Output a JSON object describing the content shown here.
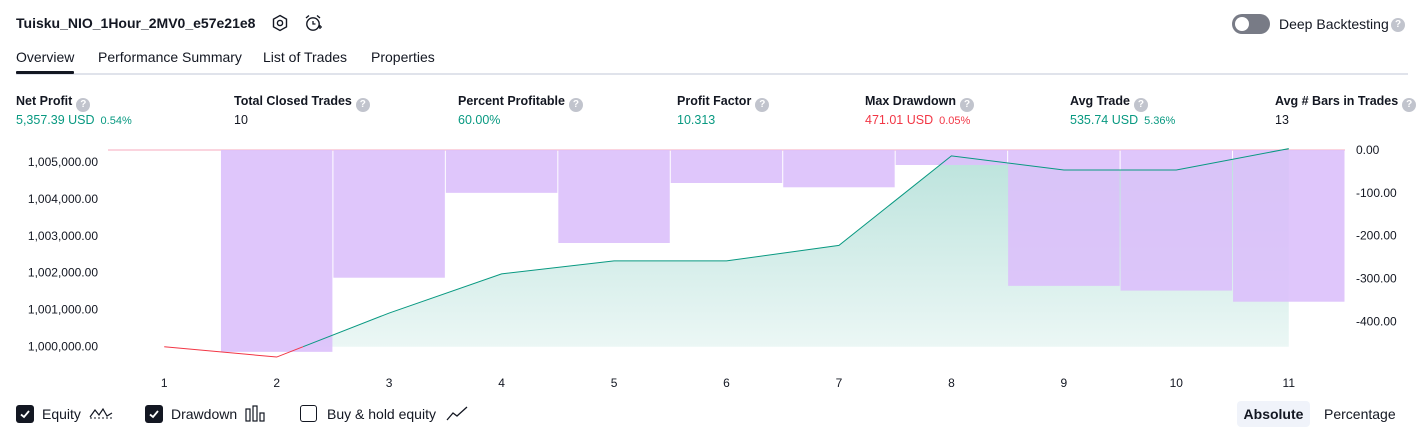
{
  "header": {
    "title": "Tuisku_NIO_1Hour_2MV0_e57e21e8",
    "deep_backtesting_label": "Deep Backtesting",
    "deep_backtesting_enabled": false
  },
  "tabs": [
    {
      "label": "Overview",
      "active": true
    },
    {
      "label": "Performance Summary",
      "active": false
    },
    {
      "label": "List of Trades",
      "active": false
    },
    {
      "label": "Properties",
      "active": false
    }
  ],
  "stats": [
    {
      "label": "Net Profit",
      "value": "5,357.39 USD",
      "sub": "0.54%",
      "color": "#089981"
    },
    {
      "label": "Total Closed Trades",
      "value": "10",
      "sub": "",
      "color": "#131722"
    },
    {
      "label": "Percent Profitable",
      "value": "60.00%",
      "sub": "",
      "color": "#089981"
    },
    {
      "label": "Profit Factor",
      "value": "10.313",
      "sub": "",
      "color": "#089981"
    },
    {
      "label": "Max Drawdown",
      "value": "471.01 USD",
      "sub": "0.05%",
      "color": "#f23645"
    },
    {
      "label": "Avg Trade",
      "value": "535.74 USD",
      "sub": "5.36%",
      "color": "#089981"
    },
    {
      "label": "Avg # Bars in Trades",
      "value": "13",
      "sub": "",
      "color": "#131722"
    }
  ],
  "chart_data": {
    "type": "line",
    "x": [
      1,
      2,
      3,
      4,
      5,
      6,
      7,
      8,
      9,
      10,
      11
    ],
    "x_tick_labels": [
      "1",
      "2",
      "3",
      "4",
      "5",
      "6",
      "7",
      "8",
      "9",
      "10",
      "11"
    ],
    "series": [
      {
        "name": "Equity",
        "type": "area",
        "values": [
          1000000,
          999720,
          1000910,
          1001970,
          1002320,
          1002320,
          1002740,
          1005160,
          1004780,
          1004780,
          1005357
        ],
        "color_above": "#089981",
        "color_below": "#f23645"
      },
      {
        "name": "Drawdown",
        "type": "bar",
        "axis": "right",
        "values": [
          0,
          -471,
          -298,
          -100,
          -217,
          -77,
          -87,
          -35,
          -317,
          -328,
          -354
        ],
        "color": "#dcc0fb"
      }
    ],
    "left_axis": {
      "ylim": [
        999640,
        1005320
      ],
      "tick_values": [
        1000000,
        1001000,
        1002000,
        1003000,
        1004000,
        1005000
      ],
      "tick_labels": [
        "1,000,000.00",
        "1,001,000.00",
        "1,002,000.00",
        "1,003,000.00",
        "1,004,000.00",
        "1,005,000.00"
      ]
    },
    "right_axis": {
      "ylim": [
        -490,
        0
      ],
      "tick_values": [
        0,
        -100,
        -200,
        -300,
        -400
      ],
      "tick_labels": [
        "0.00",
        "-100.00",
        "-200.00",
        "-300.00",
        "-400.00"
      ]
    },
    "baseline": 1000000
  },
  "legend": [
    {
      "label": "Equity",
      "checked": true,
      "icon": "equity-line-icon"
    },
    {
      "label": "Drawdown",
      "checked": true,
      "icon": "drawdown-bars-icon"
    },
    {
      "label": "Buy & hold equity",
      "checked": false,
      "icon": "buy-hold-line-icon"
    }
  ],
  "mode_buttons": {
    "absolute": "Absolute",
    "percentage": "Percentage",
    "active": "absolute"
  }
}
